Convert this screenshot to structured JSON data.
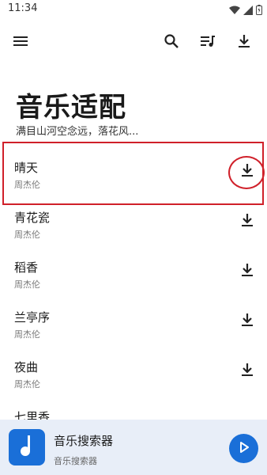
{
  "status_bar": {
    "time": "11:34"
  },
  "toolbar": {
    "icons": [
      "menu-icon",
      "search-icon",
      "playlist-icon",
      "download-icon"
    ]
  },
  "header": {
    "title": "音乐适配",
    "subtitle": "满目山河空念远，落花风..."
  },
  "songs": [
    {
      "title": "晴天",
      "artist": "周杰伦"
    },
    {
      "title": "青花瓷",
      "artist": "周杰伦"
    },
    {
      "title": "稻香",
      "artist": "周杰伦"
    },
    {
      "title": "兰亭序",
      "artist": "周杰伦"
    },
    {
      "title": "夜曲",
      "artist": "周杰伦"
    },
    {
      "title": "七里香",
      "artist": ""
    }
  ],
  "player": {
    "title": "音乐搜索器",
    "subtitle": "音乐搜索器"
  },
  "colors": {
    "accent": "#1a6fd8",
    "annotation": "#d0202a",
    "player_bg": "#e8eef8"
  }
}
